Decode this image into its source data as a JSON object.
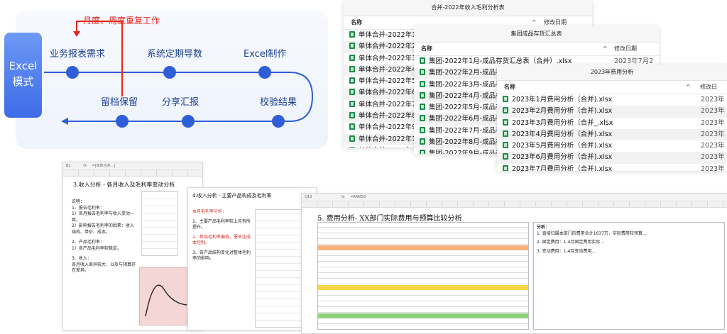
{
  "diagram": {
    "excel_mode": "Excel\n模式",
    "loop_label": "月度、周度重复工作",
    "top_steps": [
      "业务报表需求",
      "系统定期导数",
      "Excel制作"
    ],
    "bottom_steps": [
      "留档保留",
      "分享汇报",
      "校验结果"
    ]
  },
  "colors": {
    "accent": "#2f5fd8",
    "excel_box": "#4a78ee",
    "loop_arrow": "#e8241f",
    "label_text": "#1a3d8f"
  },
  "windows": [
    {
      "title": "合并-2022年收入毛利分析表",
      "col_name": "名称",
      "col_date": "",
      "files": [
        "单体合并-2022年1",
        "单体合并-2022年2",
        "单体合并-2022年3",
        "单体合并-2022年4",
        "单体合并-2022年5",
        "单体合并-2022年6",
        "单体合并-2022年7",
        "单体合并-2022年8",
        "单体合并-2022年9",
        "单体合并-2022年10",
        "单体合并-2022年11"
      ],
      "dates": []
    },
    {
      "title": "集团成品存货汇总表",
      "col_name": "名称",
      "col_date": "修改日期",
      "files": [
        "集团-2022年1月-成品存货汇总表（合并）.xlsx",
        "集团-2022年2月-成品存",
        "集团-2022年3月-成品存",
        "集团-2022年4月-成品存",
        "集团-2022年5月-成品存",
        "集团-2022年6月-成品存",
        "集团-2022年7月-成品存",
        "集团-2022年8月-成品存",
        "集团-2022年9月-成品存",
        "集团-2022年上半年-成品"
      ],
      "dates": [
        "2023年7月2"
      ]
    },
    {
      "title": "2023年费用分析",
      "col_name": "名称",
      "col_date": "修改日",
      "files": [
        "2023年1月费用分析（合并).xlsx",
        "2023年2月费用分析（合并).xlsx",
        "2023年3月费用分析（合并_.xlsx",
        "2023年4月费用分析（合并).xlsx",
        "2023年5月费用分析（合并).xlsx",
        "2023年6月费用分析（合并).xlsx",
        "2023年7月费用分析（合并).xlsx"
      ],
      "dates": [
        "2023年",
        "2023年",
        "2023年",
        "2023年",
        "2023年",
        "2023年",
        "2023年"
      ]
    }
  ],
  "win1_date_col": "修改日期",
  "sheets": {
    "sheet1": {
      "cell_ref": "B1",
      "formula": "=[单体合并...]",
      "title": "3.收入分析 - 各月收入及毛利率变动分析",
      "notes": [
        "说明：",
        "1、报告毛利率：",
        "1）各月报告毛利率与收入变动一致。",
        "2）影响报告毛利率的因素：收入结构、单价、成本。",
        "2、产品毛利率：",
        "1）各产品毛利率较稳定。",
        "3、收入：",
        "各月收入差异较大，以及与预算存在差异。"
      ]
    },
    "sheet2": {
      "title": "4.收入分析 - 主要产品构成及毛利率",
      "notes": [
        "本月毛利率分析：",
        "1、主要产品毛利率较上月有所提升。",
        "2、新品毛利率偏低，需关注成本控制。",
        "3、各产品结构变化对整体毛利率的影响。"
      ]
    },
    "sheet3": {
      "cell_ref": "Q13",
      "formula": "=RANDO",
      "title": "5. 费用分析- XX部门实际费用与预算比较分析",
      "notes": [
        "分析：",
        "1. 直接归属本部门的费用合计1637万，实际费用较预算...",
        "2. 固定费用：1-4月固定费用实际...",
        "3. 变动费用：1-4月变动费用..."
      ]
    }
  }
}
